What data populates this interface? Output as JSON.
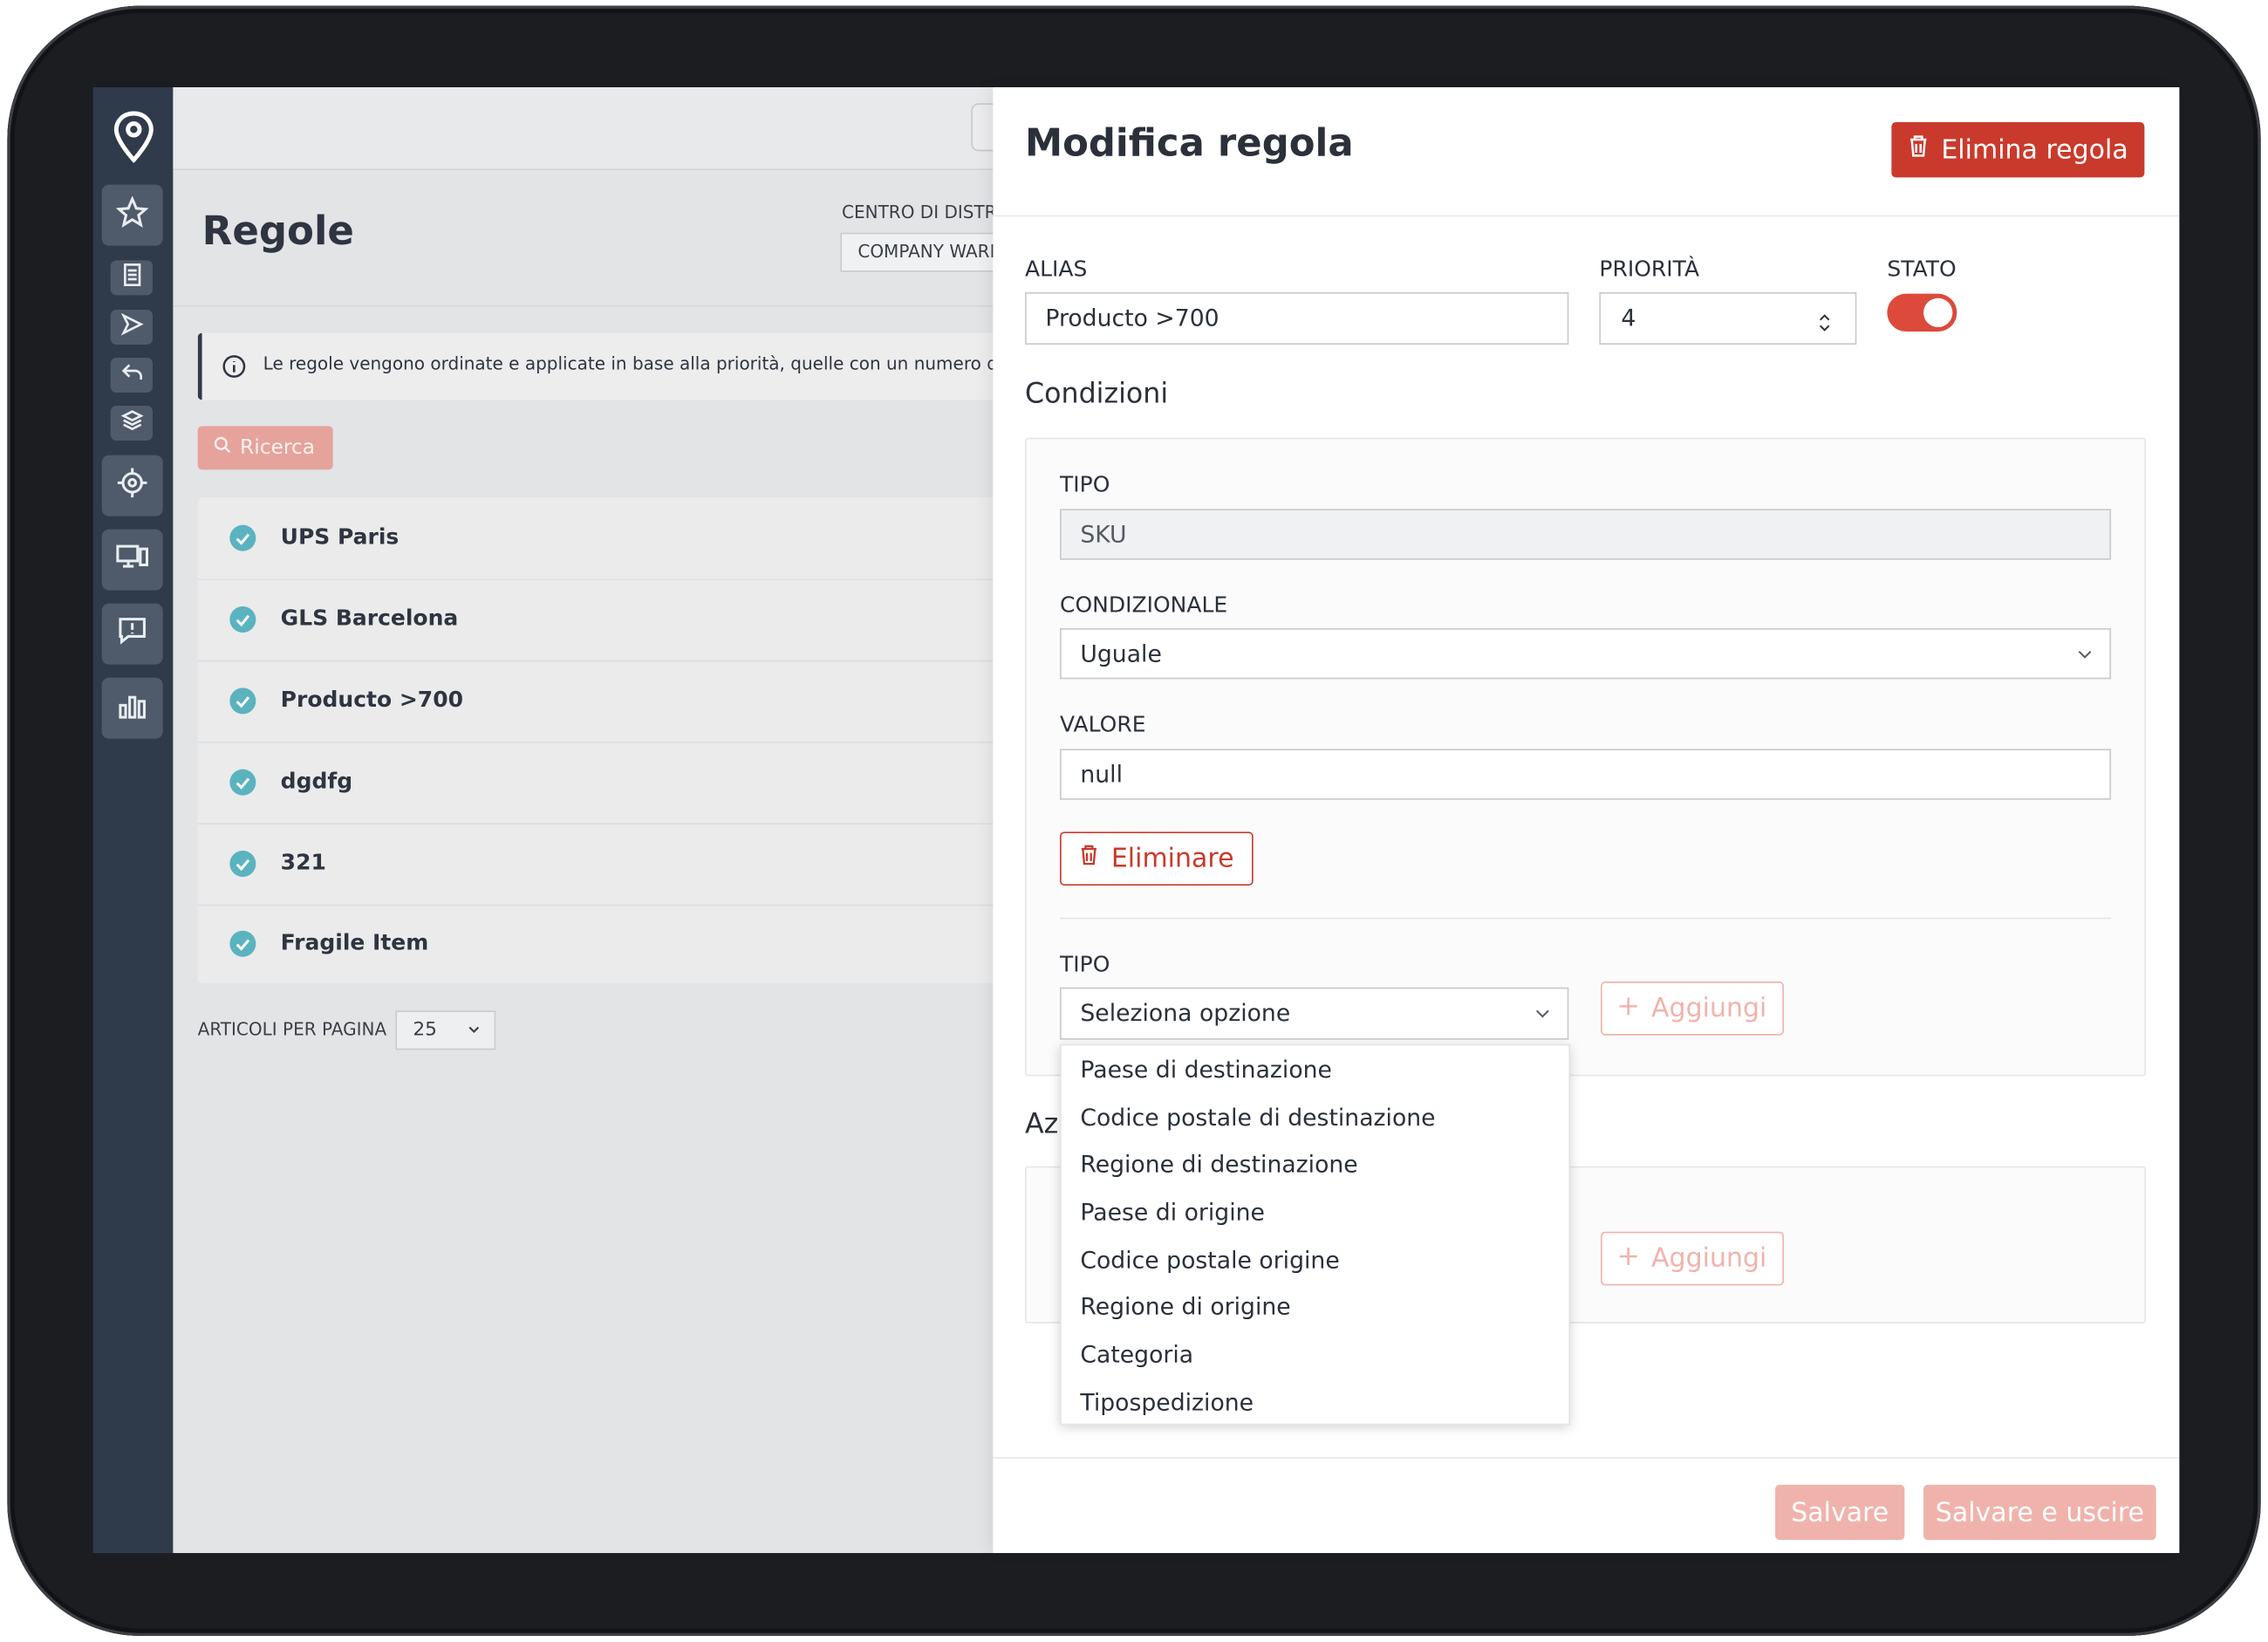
{
  "sidebar": {
    "logo_icon": "location-pin-logo",
    "items": [
      {
        "icon": "star-icon"
      },
      {
        "icon": "document-icon"
      },
      {
        "icon": "send-icon"
      },
      {
        "icon": "return-icon"
      },
      {
        "icon": "layers-icon"
      },
      {
        "icon": "target-icon"
      },
      {
        "icon": "devices-icon"
      },
      {
        "icon": "alert-message-icon"
      },
      {
        "icon": "bar-chart-icon"
      }
    ]
  },
  "background_page": {
    "title": "Regole",
    "distribution_center": {
      "label": "CENTRO DI DISTRIE",
      "value": "COMPANY WARI"
    },
    "info_text": "Le regole vengono ordinate e applicate in base alla priorità, quelle con un numero di p",
    "search_label": "Ricerca",
    "rules": [
      "UPS Paris",
      "GLS Barcelona",
      "Producto >700",
      "dgdfg",
      "321",
      "Fragile Item"
    ],
    "items_per_page": {
      "label": "ARTICOLI PER PAGINA",
      "value": "25"
    }
  },
  "panel": {
    "title": "Modifica regola",
    "delete_rule_label": "Elimina regola",
    "alias": {
      "label": "ALIAS",
      "value": "Producto >700"
    },
    "priority": {
      "label": "PRIORITÀ",
      "value": "4"
    },
    "status": {
      "label": "STATO",
      "enabled": true
    },
    "conditions_title": "Condizioni",
    "condition": {
      "type_label": "TIPO",
      "type_value": "SKU",
      "conditional_label": "CONDIZIONALE",
      "conditional_value": "Uguale",
      "value_label": "VALORE",
      "value_value": "null",
      "delete_label": "Eliminare"
    },
    "new_condition": {
      "type_label": "TIPO",
      "placeholder": "Seleziona opzione",
      "add_label": "Aggiungi",
      "options": [
        "Paese di destinazione",
        "Codice postale di destinazione",
        "Regione di destinazione",
        "Paese di origine",
        "Codice postale origine",
        "Regione di origine",
        "Categoria",
        "Tipospedizione"
      ]
    },
    "actions_title_visible": "Azi",
    "actions_add_label": "Aggiungi",
    "save_label": "Salvare",
    "save_exit_label": "Salvare e uscire"
  },
  "colors": {
    "accent_red": "#c93a2c",
    "accent_red_light": "#f0b3ac",
    "sidebar_bg": "#2f3a4b",
    "check_teal": "#5bb3bf"
  }
}
